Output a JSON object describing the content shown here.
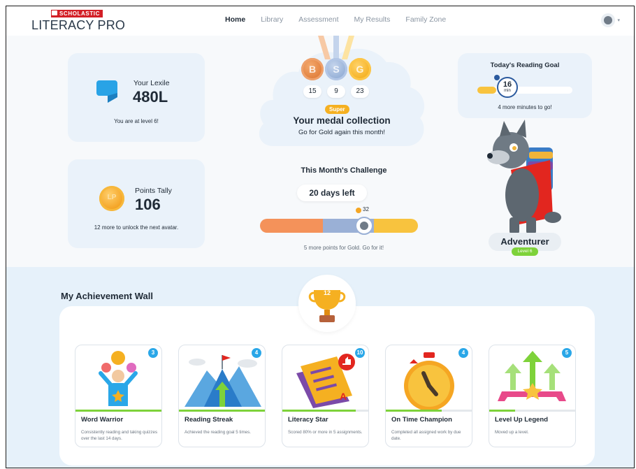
{
  "header": {
    "brand": "SCHOLASTIC",
    "product": "LITERACY PRO",
    "nav": [
      {
        "label": "Home",
        "active": true
      },
      {
        "label": "Library",
        "active": false
      },
      {
        "label": "Assessment",
        "active": false
      },
      {
        "label": "My Results",
        "active": false
      },
      {
        "label": "Family Zone",
        "active": false
      }
    ],
    "avatar_icon": "wolf-avatar-icon",
    "menu_icon": "chevron-down-icon"
  },
  "lexile": {
    "label": "Your Lexile",
    "value": "480L",
    "subtitle": "You are at level 6!"
  },
  "points": {
    "label": "Points Tally",
    "value": "106",
    "coin_label": "LP",
    "subtitle": "12 more to unlock the next avatar."
  },
  "medals": {
    "bronze": {
      "letter": "B",
      "count": "15"
    },
    "silver": {
      "letter": "S",
      "count": "9"
    },
    "gold": {
      "letter": "G",
      "count": "23"
    },
    "badge": "Super",
    "title": "Your medal collection",
    "subtitle": "Go for Gold again this month!"
  },
  "challenge": {
    "title": "This Month's Challenge",
    "days_left": "20 days left",
    "points": "32",
    "progress": {
      "bronze_share": 0.4,
      "silver_share": 0.32,
      "gold_share": 0.28,
      "marker_position": 0.6
    },
    "subtitle": "5 more points for Gold. Go for it!"
  },
  "reading_goal": {
    "title": "Today's Reading Goal",
    "minutes": "16",
    "unit": "min",
    "progress": 0.2,
    "subtitle": "4 more minutes to go!"
  },
  "character": {
    "name": "Adventurer",
    "level": "Level 6"
  },
  "achievements": {
    "title": "My Achievement Wall",
    "trophy_count": "12",
    "items": [
      {
        "name": "Word Warrior",
        "count": "3",
        "progress": 1.0,
        "desc": "Consistently reading and taking quizzes over the last 14 days.",
        "icon": "word-warrior-icon"
      },
      {
        "name": "Reading Streak",
        "count": "4",
        "progress": 1.0,
        "desc": "Achieved the reading goal 5 times.",
        "icon": "mountain-flag-icon"
      },
      {
        "name": "Literacy Star",
        "count": "10",
        "progress": 0.85,
        "desc": "Scored 80% or more in 5 assignments.",
        "icon": "checklist-icon"
      },
      {
        "name": "On Time Champion",
        "count": "4",
        "progress": 0.65,
        "desc": "Completed all assigned work by due date.",
        "icon": "stopwatch-icon"
      },
      {
        "name": "Level Up Legend",
        "count": "5",
        "progress": 0.3,
        "desc": "Moved up a level.",
        "icon": "level-up-arrows-icon"
      }
    ]
  },
  "colors": {
    "accent_blue": "#2aa7e8",
    "card_bg": "#eaf2fa",
    "bronze": "#f4925a",
    "silver": "#9ab0d6",
    "gold": "#f8c33e",
    "green": "#7ed23a"
  }
}
